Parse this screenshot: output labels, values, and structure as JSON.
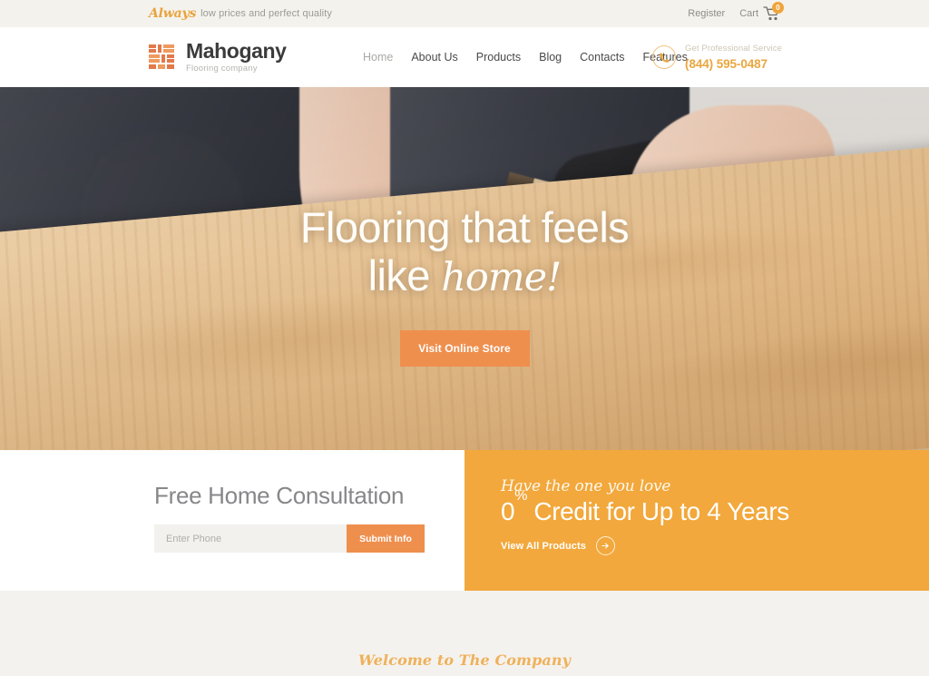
{
  "topbar": {
    "tagline_script": "Always",
    "tagline_rest": "low prices and perfect quality",
    "register_label": "Register",
    "cart_label": "Cart",
    "cart_count": "0"
  },
  "header": {
    "logo_title": "Mahogany",
    "logo_subtitle": "Flooring company",
    "nav": [
      {
        "label": "Home",
        "active": true
      },
      {
        "label": "About Us",
        "active": false
      },
      {
        "label": "Products",
        "active": false
      },
      {
        "label": "Blog",
        "active": false
      },
      {
        "label": "Contacts",
        "active": false
      },
      {
        "label": "Features",
        "active": false
      }
    ],
    "phone_label": "Get Professional Service",
    "phone_number": "(844) 595-0487"
  },
  "hero": {
    "title_line1": "Flooring that feels",
    "title_line2_plain": "like ",
    "title_line2_script": "home!",
    "cta_label": "Visit Online Store",
    "slides": [
      "slide-1",
      "slide-2",
      "slide-3"
    ],
    "active_slide": 1
  },
  "consultation": {
    "title": "Free Home Consultation",
    "input_placeholder": "Enter Phone",
    "input_value": "",
    "submit_label": "Submit Info"
  },
  "promo": {
    "script_line": "Have the one you love",
    "headline_prefix": "0",
    "headline_sup": "%",
    "headline_rest": " Credit for Up to 4 Years",
    "link_label": "View All Products"
  },
  "bottom": {
    "welcome_script": "Welcome to The Company"
  },
  "colors": {
    "accent_orange": "#ef8f4e",
    "promo_orange": "#f2a83c",
    "gold": "#eaa63f",
    "page_bg": "#f4f2ee",
    "text_dark": "#3b3b3b",
    "text_muted": "#9b9b96"
  }
}
